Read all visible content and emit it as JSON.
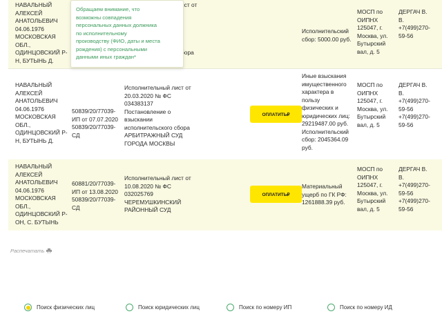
{
  "tooltip": {
    "text": "Обращаем внимание, что\nвозможны совпадения\nперсональных данных должника\nпо исполнительному\nпроизводству (ФИО, даты и места\nрождения) с персональными\nданными иных граждан*"
  },
  "rows": [
    {
      "debtor": "НАВАЛЬНЫЙ\nАЛЕКСЕЙ\nАНАТОЛЬЕВИЧ\n04.06.1976\nМОСКОВСКАЯ\nОБЛ.,\nОДИНЦОВСКИЙ Р-\nН, БУТЫНЬ Д.",
      "doc": "ист от\n\n\n\n\n\nбора",
      "subject": "Исполнительский\nсбор: 5000.00 руб.",
      "department": "МОСП по\nОИПНХ\n125047, г.\nМосква, ул.\nБутырский\nвал, д. 5",
      "bailiff": "ДЕРГАЧ В.\nВ.\n+7(499)270-\n59-56"
    },
    {
      "debtor": "НАВАЛЬНЫЙ\nАЛЕКСЕЙ\nАНАТОЛЬЕВИЧ\n04.06.1976\nМОСКОВСКАЯ\nОБЛ.,\nОДИНЦОВСКИЙ Р-\nН, БУТЫНЬ Д.",
      "ip": "50839/20/77039-\nИП от 07.07.2020\n50839/20/77039-\nСД",
      "doc": "Исполнительный лист от\n20.03.2020 № ФС\n034383137\nПостановление о\nвзыскании\nисполнительского сбора\nАРБИТРАЖНЫЙ СУД\nГОРОДА МОСКВЫ",
      "pay": "ОПЛАТИТЬ₽",
      "subject": "Иные взыскания\nимущественного\nхарактера в\nпользу\nфизических и\nюридических лиц:\n29219487.00 руб.\nИсполнительский\nсбор: 2045364.09\nруб.",
      "department": "МОСП по\nОИПНХ\n125047, г.\nМосква, ул.\nБутырский\nвал, д. 5",
      "bailiff": "ДЕРГАЧ В.\nВ.\n+7(499)270-\n59-56\n+7(499)270-\n59-56"
    },
    {
      "debtor": "НАВАЛЬНЫЙ\nАЛЕКСЕЙ\nАНАТОЛЬЕВИЧ\n04.06.1976\nМОСКОВСКАЯ\nОБЛ.,\nОДИНЦОВСКИЙ Р-\nОН, С. БУТЫНЬ",
      "ip": "60881/20/77039-\nИП от 13.08.2020\n50839/20/77039-\nСД",
      "doc": "Исполнительный лист от\n10.08.2020 № ФС\n032025769\nЧЕРЕМУШКИНСКИЙ\nРАЙОННЫЙ СУД",
      "pay": "ОПЛАТИТЬ₽",
      "subject": "Материальный\nущерб по ГК РФ:\n1261888.39 руб.",
      "department": "МОСП по\nОИПНХ\n125047, г.\nМосква, ул.\nБутырский\nвал, д. 5",
      "bailiff": "ДЕРГАЧ В.\nВ.\n+7(499)270-\n59-56\n+7(499)270-\n59-56"
    }
  ],
  "print_label": "Распечатать",
  "search_modes": [
    {
      "label": "Поиск физических лиц",
      "selected": true
    },
    {
      "label": "Поиск юридических лиц",
      "selected": false
    },
    {
      "label": "Поиск по номеру ИП",
      "selected": false
    },
    {
      "label": "Поиск по номеру ИД",
      "selected": false
    }
  ],
  "colors": {
    "accent_yellow": "#ffe600",
    "row_yellow": "#fafae3",
    "radio_green": "#4aa96c"
  }
}
